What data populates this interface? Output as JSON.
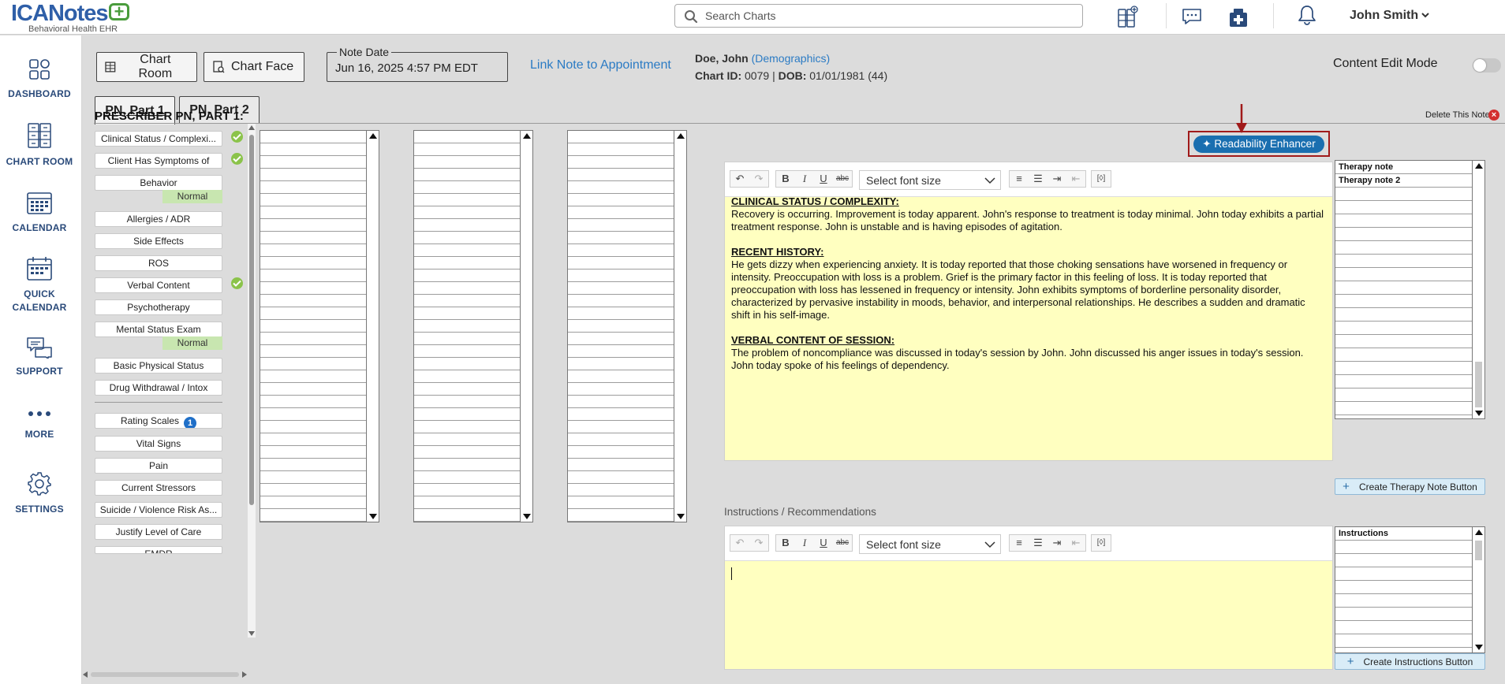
{
  "header": {
    "logo_main_a": "ICA",
    "logo_main_b": "Notes",
    "logo_plus": "+",
    "logo_sub": "Behavioral Health EHR",
    "search_placeholder": "Search Charts",
    "user_name": "John Smith"
  },
  "nav": {
    "items": [
      {
        "label": "DASHBOARD",
        "icon": "dashboard-icon"
      },
      {
        "label": "CHART ROOM",
        "icon": "chart-room-icon"
      },
      {
        "label": "CALENDAR",
        "icon": "calendar-icon"
      },
      {
        "label": "QUICK CALENDAR",
        "icon": "quick-calendar-icon"
      },
      {
        "label": "SUPPORT",
        "icon": "support-icon"
      },
      {
        "label": "MORE",
        "icon": "more-icon"
      },
      {
        "label": "SETTINGS",
        "icon": "settings-icon"
      }
    ]
  },
  "toolbar": {
    "chart_room": "Chart Room",
    "chart_face": "Chart Face",
    "note_date_label": "Note Date",
    "note_date_value": "Jun 16, 2025 4:57 PM EDT",
    "link_appt": "Link Note to Appointment",
    "content_edit_mode": "Content Edit Mode",
    "content_edit_on": false
  },
  "patient": {
    "name": "Doe, John",
    "demographics_link": "(Demographics)",
    "chart_id_label": "Chart ID:",
    "chart_id": "0079",
    "sep": "|",
    "dob_label": "DOB:",
    "dob": "01/01/1981 (44)"
  },
  "tabs": [
    {
      "label": "PN, Part 1",
      "active": true
    },
    {
      "label": "PN, Part 2",
      "active": false
    }
  ],
  "note": {
    "section_title": "PRESCRIBER PN, PART 1:",
    "delete_label": "Delete This Note",
    "delete_icon": "×"
  },
  "sections": [
    {
      "label": "Clinical Status / Complexi...",
      "checked": true
    },
    {
      "label": "Client Has Symptoms of",
      "checked": true
    },
    {
      "label": "Behavior",
      "status": "Normal"
    },
    {
      "label": "Allergies / ADR"
    },
    {
      "label": "Side Effects"
    },
    {
      "label": "ROS"
    },
    {
      "label": "Verbal Content",
      "checked": true
    },
    {
      "label": "Psychotherapy"
    },
    {
      "label": "Mental Status Exam",
      "status": "Normal"
    },
    {
      "label": "Basic Physical Status"
    },
    {
      "label": "Drug Withdrawal / Intox"
    },
    {
      "label": "Rating Scales",
      "badge": "1"
    },
    {
      "label": "Vital Signs"
    },
    {
      "label": "Pain"
    },
    {
      "label": "Current Stressors"
    },
    {
      "label": "Suicide / Violence Risk As..."
    },
    {
      "label": "Justify Level of Care"
    },
    {
      "label": "EMDR"
    }
  ],
  "editor": {
    "font_select": "Select font size",
    "readability_button": "Readability Enhancer",
    "content": [
      {
        "heading": "CLINICAL STATUS / COMPLEXITY:",
        "text": "Recovery is occurring. Improvement is today apparent. John's response to treatment is today minimal. John today exhibits a partial treatment response. John is unstable and is having episodes of agitation."
      },
      {
        "heading": "RECENT HISTORY:",
        "text": "He gets dizzy when experiencing anxiety. It is today reported that those choking sensations have worsened in frequency or intensity. Preoccupation with loss is a problem. Grief is the primary factor in this feeling of loss. It is today reported that preoccupation with loss has lessened in frequency or intensity. John exhibits symptoms of borderline personality disorder, characterized by pervasive instability in moods, behavior, and interpersonal relationships. He describes a sudden and dramatic shift in his self-image."
      },
      {
        "heading": "VERBAL CONTENT OF SESSION:",
        "text": "The problem of noncompliance was discussed in today's session by John. John discussed his anger issues in today's session. John today spoke of his feelings of dependency."
      }
    ]
  },
  "therapy_list": {
    "items": [
      "Therapy note",
      "Therapy note 2"
    ],
    "create_button": "Create Therapy Note Button"
  },
  "instructions": {
    "label": "Instructions / Recommendations",
    "font_select": "Select font size",
    "list_header": "Instructions",
    "create_button": "Create Instructions Button"
  }
}
